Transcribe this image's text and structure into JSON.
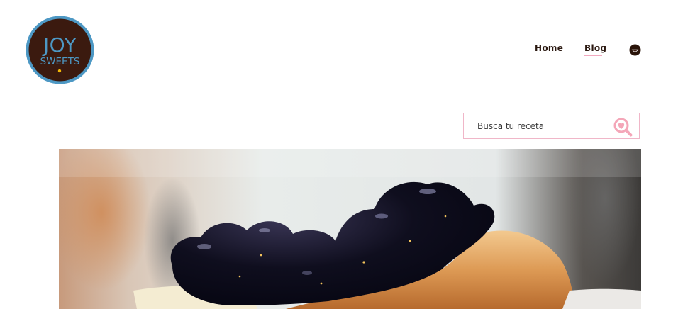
{
  "brand": {
    "logo_line1": "JOY",
    "logo_line2": "SWEETS",
    "colors": {
      "logo_bg": "#3b1a0f",
      "logo_ring": "#4d98c4",
      "logo_text": "#4d98c4",
      "logo_dot": "#f2b705"
    }
  },
  "nav": {
    "items": [
      {
        "label": "Home",
        "active": false
      },
      {
        "label": "Blog",
        "active": true
      }
    ],
    "account_icon": "smiley-icon",
    "active_underline_color": "#f2a8bf"
  },
  "search": {
    "placeholder": "Busca tu receta",
    "value": "",
    "icon": "heart-magnifier-icon",
    "border_color": "#f0b6c8",
    "icon_color": "#f4a6b8"
  },
  "hero": {
    "image": "blueberry-cheesecake-photo"
  }
}
